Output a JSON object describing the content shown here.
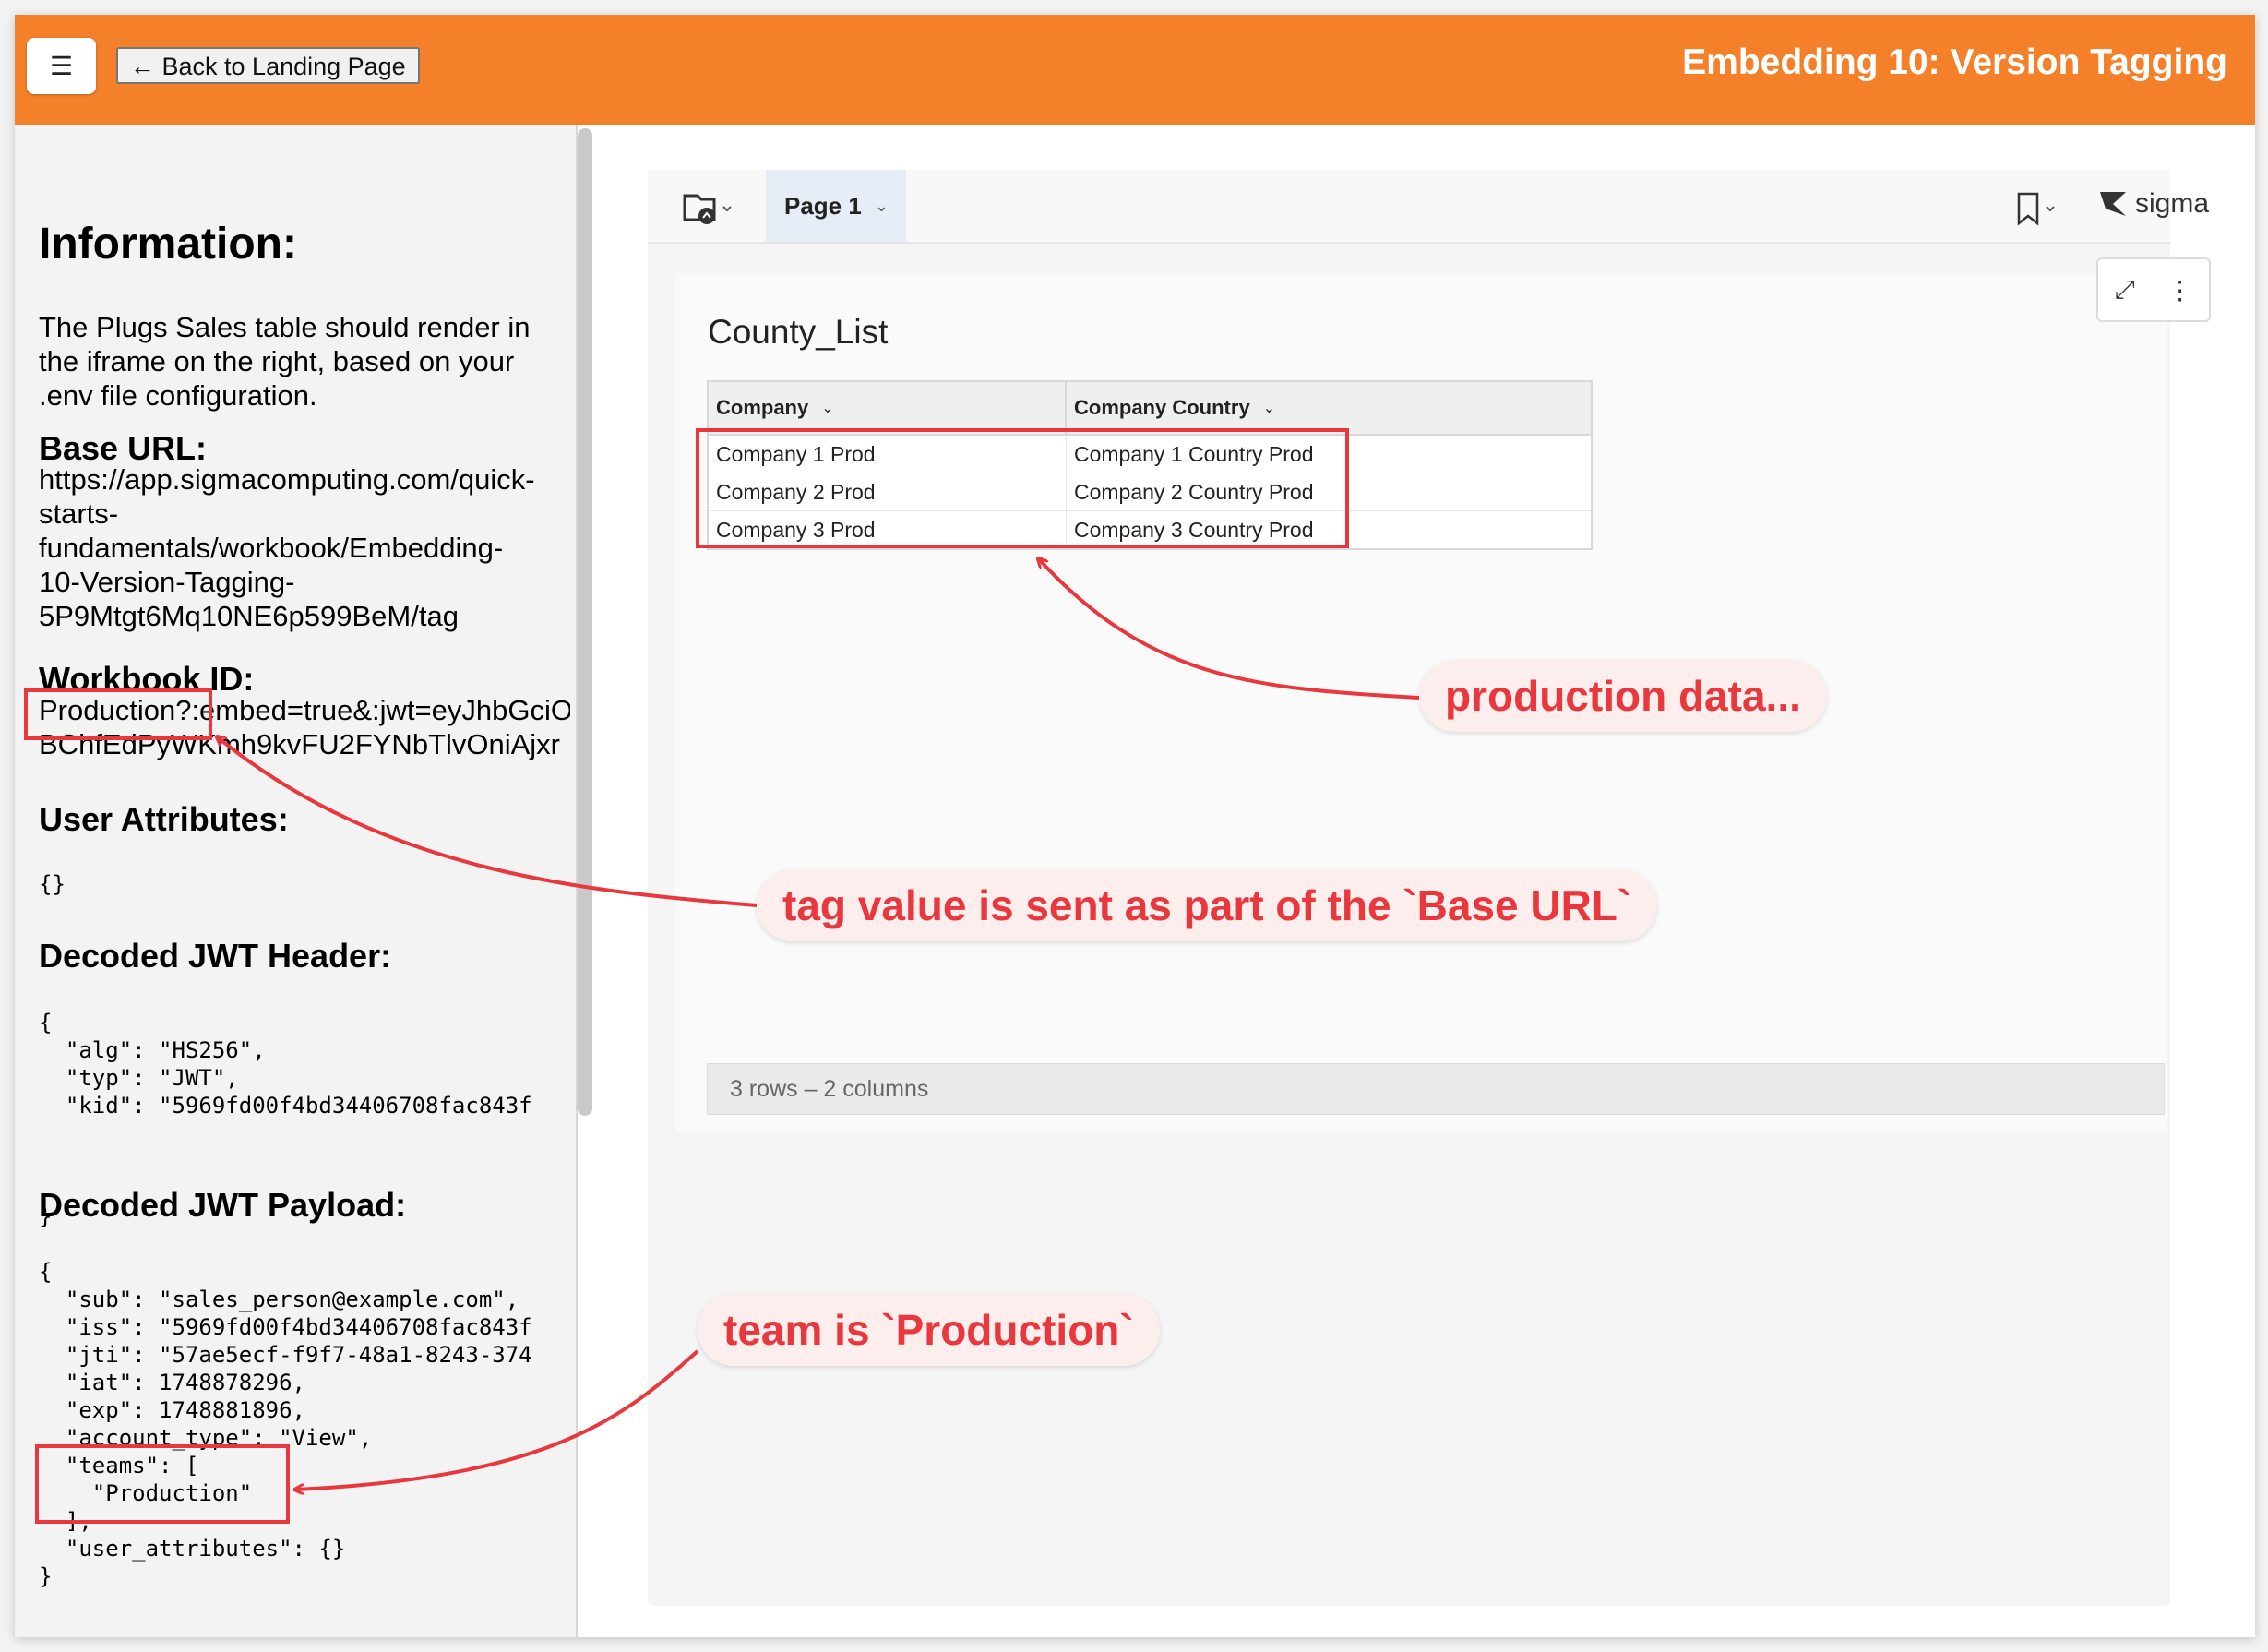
{
  "header": {
    "menu_icon": "hamburger-icon",
    "back_label": "← Back to Landing Page",
    "title": "Embedding 10: Version Tagging",
    "background_color": "#f4802a"
  },
  "sidebar": {
    "info_heading": "Information:",
    "info_text": "The Plugs Sales table should render in the iframe on the right, based on your .env file configuration.",
    "base_url_heading": "Base URL:",
    "base_url_lines": [
      "https://app.sigmacomputing.com/quick-",
      "starts-",
      "fundamentals/workbook/Embedding-",
      "10-Version-Tagging-",
      "5P9Mtgt6Mq10NE6p599BeM/tag"
    ],
    "workbook_id_heading": "Workbook ID:",
    "workbook_id_lines": [
      "Production?:embed=true&:jwt=eyJhbGciO",
      "BChfEdPyWKmh9kvFU2FYNbTlvOniAjxr"
    ],
    "user_attributes_heading": "User Attributes:",
    "user_attributes_value": "{}",
    "jwt_header_heading": "Decoded JWT Header:",
    "jwt_header_code": "{\n  \"alg\": \"HS256\",\n  \"typ\": \"JWT\",\n  \"kid\": \"5969fd00f4bd34406708fac843f",
    "jwt_header_close": "}",
    "jwt_payload_heading": "Decoded JWT Payload:",
    "jwt_payload_code": "{\n  \"sub\": \"sales_person@example.com\",\n  \"iss\": \"5969fd00f4bd34406708fac843f\n  \"jti\": \"57ae5ecf-f9f7-48a1-8243-374\n  \"iat\": 1748878296,\n  \"exp\": 1748881896,\n  \"account_type\": \"View\",\n  \"teams\": [\n    \"Production\"\n  ],\n  \"user_attributes\": {}\n}"
  },
  "embed": {
    "folder_icon": "folder-icon",
    "page_tab": "Page 1",
    "bookmark_icon": "bookmark-icon",
    "brand": "sigma",
    "expand_icon": "expand-icon",
    "more_icon": "more-vertical-icon",
    "table_title": "County_List",
    "columns": [
      "Company",
      "Company Country"
    ],
    "rows": [
      [
        "Company 1 Prod",
        "Company 1 Country Prod"
      ],
      [
        "Company 2 Prod",
        "Company 2 Country Prod"
      ],
      [
        "Company 3 Prod",
        "Company 3 Country Prod"
      ]
    ],
    "footer": "3 rows – 2 columns"
  },
  "annotations": {
    "production_data": "production data...",
    "tag_value": "tag value is sent as part of the `Base URL`",
    "team": "team is `Production`",
    "accent_color": "#e8383d"
  }
}
